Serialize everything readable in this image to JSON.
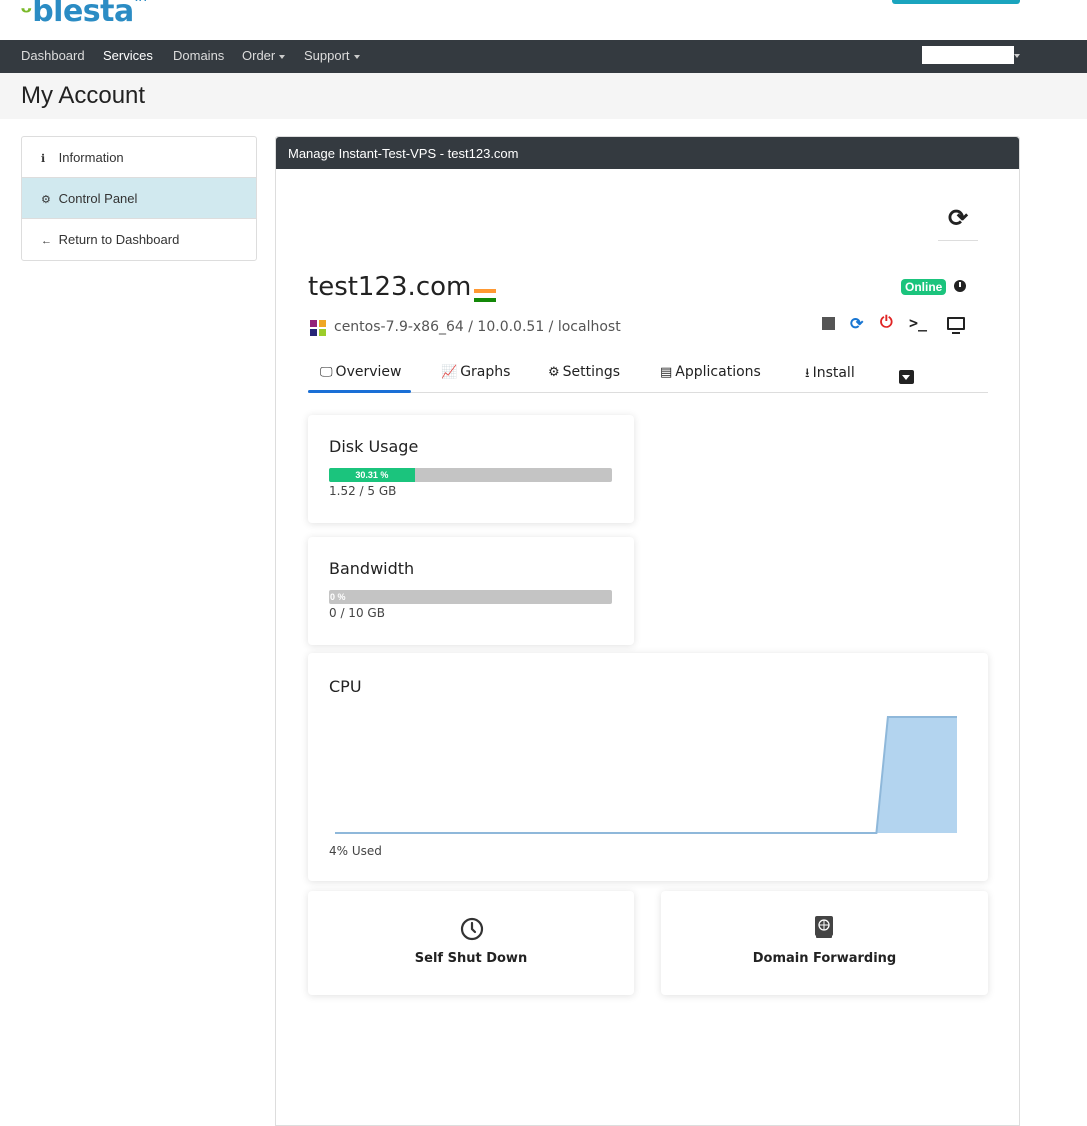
{
  "brand": {
    "logo_text": "blesta",
    "tm": "TM"
  },
  "nav": {
    "items": [
      "Dashboard",
      "Services",
      "Domains",
      "Order",
      "Support"
    ]
  },
  "page": {
    "title": "My Account"
  },
  "sidebar": {
    "items": [
      {
        "label": "Information",
        "icon": "info-icon"
      },
      {
        "label": "Control Panel",
        "icon": "gear-icon"
      },
      {
        "label": "Return to Dashboard",
        "icon": "arrow-left-icon"
      }
    ]
  },
  "panel": {
    "heading": "Manage Instant-Test-VPS - test123.com",
    "hostname": "test123.com",
    "country_flag": "India",
    "status": "Online",
    "os_line": "centos-7.9-x86_64 / 10.0.0.51 / localhost",
    "tabs": [
      {
        "label": "Overview",
        "icon": "monitor-icon"
      },
      {
        "label": "Graphs",
        "icon": "area-chart-icon"
      },
      {
        "label": "Settings",
        "icon": "gear-icon"
      },
      {
        "label": "Applications",
        "icon": "boxes-icon"
      },
      {
        "label": "Install",
        "icon": "download-icon"
      }
    ],
    "active_tab": "Overview"
  },
  "disk": {
    "title": "Disk Usage",
    "percent_label": "30.31 %",
    "percent": 30.31,
    "usage": "1.52 / 5 GB"
  },
  "bandwidth": {
    "title": "Bandwidth",
    "percent_label": "0 %",
    "percent": 0,
    "usage": "0 / 10 GB"
  },
  "cpu": {
    "title": "CPU",
    "used_label": "4% Used",
    "chart_data": {
      "type": "area",
      "values": [
        0,
        0,
        0,
        0,
        0,
        0,
        0,
        0,
        0,
        0,
        0,
        0,
        0,
        0,
        0,
        0,
        0,
        0,
        0,
        0,
        0,
        0,
        0,
        0,
        0,
        0,
        0,
        0,
        0,
        0,
        0,
        0,
        0,
        0,
        0,
        0,
        0,
        0,
        0,
        0,
        0,
        0,
        0,
        0,
        0,
        0,
        0,
        0,
        4,
        4,
        4,
        4,
        4,
        4,
        4
      ],
      "ylim": [
        0,
        4
      ],
      "color": "#b3d4ef",
      "grid": false
    }
  },
  "actions": [
    {
      "label": "Self Shut Down",
      "icon": "clock-icon"
    },
    {
      "label": "Domain Forwarding",
      "icon": "globe-book-icon"
    }
  ],
  "colors": {
    "navbar": "#343a40",
    "accent": "#1aa4be",
    "online": "#1bc47d",
    "tab_active": "#1a6fd6"
  }
}
